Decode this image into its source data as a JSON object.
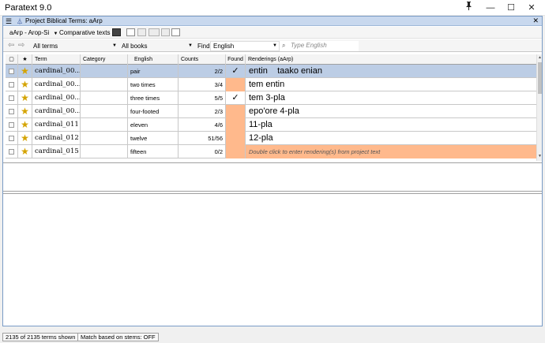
{
  "app": {
    "title": "Paratext 9.0",
    "pin_icon": "pin-icon",
    "minimize_glyph": "—",
    "maximize_glyph": "☐",
    "close_glyph": "✕"
  },
  "panel": {
    "title": "Project Biblical Terms: aArp",
    "menu_glyph": "☰",
    "icon_glyph": "⏃",
    "close_glyph": "✕"
  },
  "toolbar": {
    "project_label": "aArp - Arop-Si",
    "comparative_label": "Comparative texts",
    "terms_filter": "All terms",
    "books_filter": "All books",
    "find_label": "Find",
    "find_language": "English",
    "search_placeholder": "Type English",
    "back_glyph": "⇦",
    "forward_glyph": "⇨"
  },
  "columns": {
    "check": "▢",
    "star": "★",
    "term": "Term",
    "category": "Category",
    "english": "English",
    "counts": "Counts",
    "found": "Found",
    "renderings": "Renderings (aArp)"
  },
  "rows": [
    {
      "term": "cardinal_00...",
      "category": "",
      "english": "pair",
      "counts": "2/2",
      "found": "✓",
      "rendering": "entin    taako enian",
      "found_ok": true,
      "selected": true
    },
    {
      "term": "cardinal_00...",
      "category": "",
      "english": "two times",
      "counts": "3/4",
      "found": "",
      "rendering": "tem entin",
      "found_ok": false,
      "selected": false
    },
    {
      "term": "cardinal_00...",
      "category": "",
      "english": "three times",
      "counts": "5/5",
      "found": "✓",
      "rendering": "tem 3-pla",
      "found_ok": true,
      "selected": false
    },
    {
      "term": "cardinal_00...",
      "category": "",
      "english": "four-footed",
      "counts": "2/3",
      "found": "",
      "rendering": "epo'ore 4-pla",
      "found_ok": false,
      "selected": false
    },
    {
      "term": "cardinal_011",
      "category": "",
      "english": "eleven",
      "counts": "4/6",
      "found": "",
      "rendering": "11-pla",
      "found_ok": false,
      "selected": false
    },
    {
      "term": "cardinal_012",
      "category": "",
      "english": "twelve",
      "counts": "51/56",
      "found": "",
      "rendering": "12-pla",
      "found_ok": false,
      "selected": false
    },
    {
      "term": "cardinal_015",
      "category": "",
      "english": "fifteen",
      "counts": "0/2",
      "found": "",
      "rendering": "Double click to enter rendering(s) from project text",
      "found_ok": false,
      "selected": false,
      "hint": true
    }
  ],
  "status": {
    "terms_shown": "2135 of 2135 terms shown",
    "match_stems": "Match based on stems: OFF"
  },
  "colors": {
    "selected_row": "#bccde5",
    "missing_highlight": "#ffb98c",
    "star": "#d4a300"
  }
}
